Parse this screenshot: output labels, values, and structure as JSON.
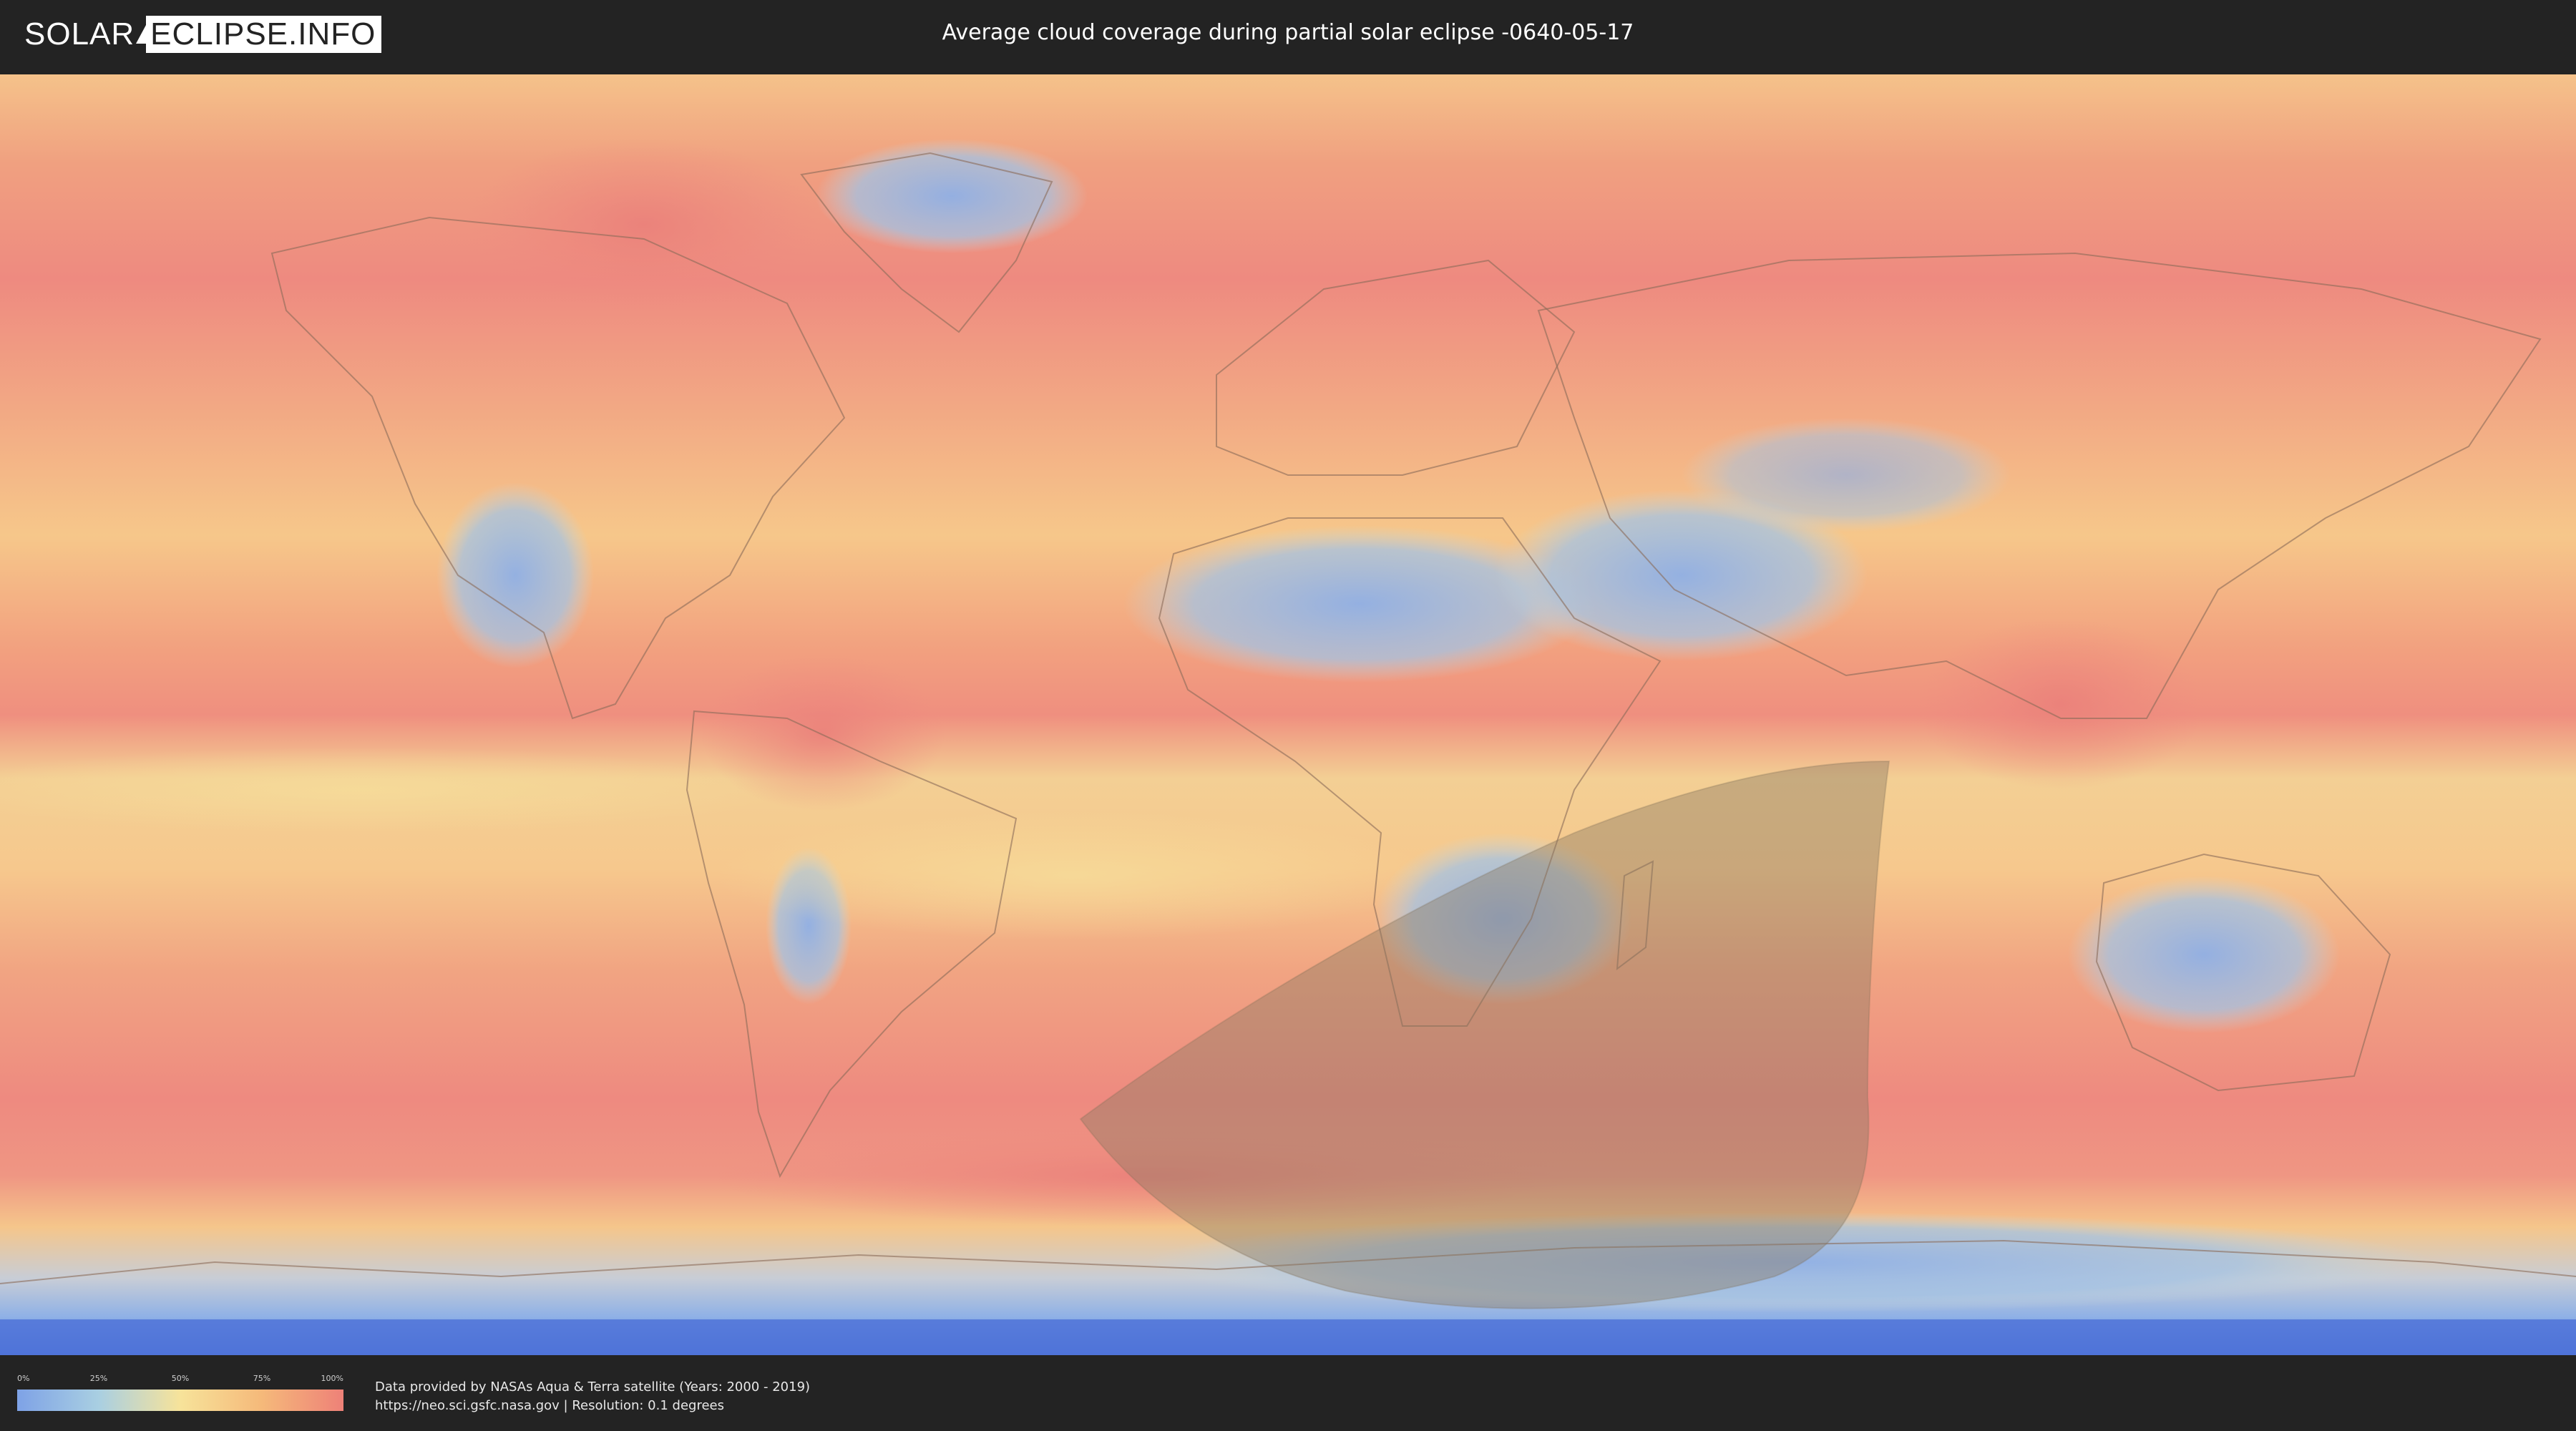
{
  "header": {
    "logo_left": "SOLAR",
    "logo_right": "ECLIPSE.INFO",
    "title": "Average cloud coverage during partial solar eclipse -0640-05-17"
  },
  "legend": {
    "ticks": [
      "0%",
      "25%",
      "50%",
      "75%",
      "100%"
    ],
    "tick_values": [
      0,
      25,
      50,
      75,
      100
    ],
    "colors": [
      "#7ea2e6",
      "#a9cfe2",
      "#f7e39a",
      "#f5b97a",
      "#ee8178"
    ]
  },
  "footer": {
    "source_line1": "Data provided by NASAs Aqua & Terra satellite (Years: 2000 - 2019)",
    "source_line2": "https://neo.sci.gsfc.nasa.gov | Resolution: 0.1 degrees"
  },
  "map": {
    "colors": {
      "high_cloud": "#ee8a80",
      "mid_cloud": "#f5bd84",
      "low_mid": "#f4d996",
      "low_cloud": "#9dbbe4",
      "very_low": "#7ea2e6",
      "antarctic_edge": "#4f73d8",
      "eclipse_shadow": "#8a7a62"
    }
  }
}
